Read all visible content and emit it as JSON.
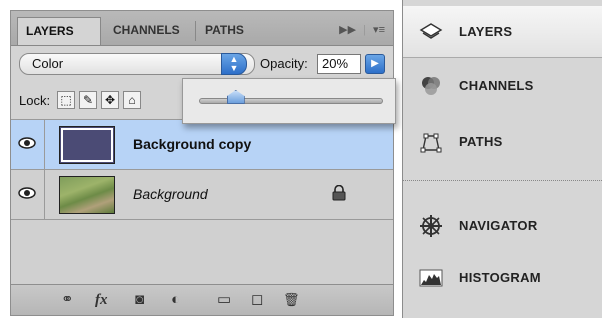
{
  "layers_panel": {
    "tabs": [
      "LAYERS",
      "CHANNELS",
      "PATHS"
    ],
    "tabbar_icons": {
      "collapse": "▶▶",
      "menu": "▾≡"
    },
    "blend_mode": "Color",
    "opacity_label": "Opacity:",
    "opacity_value": "20%",
    "opacity_slider_level": 0.2,
    "lock_label": "Lock:",
    "lock_icons": [
      "transparency-lock-icon",
      "brush-lock-icon",
      "move-lock-icon",
      "padlock-icon"
    ],
    "layers": [
      {
        "name": "Background copy",
        "selected": true,
        "visible": true,
        "locked": false
      },
      {
        "name": "Background",
        "selected": false,
        "visible": true,
        "locked": true
      }
    ],
    "bottom_icons": [
      "link-icon",
      "fx-icon",
      "mask-icon",
      "adjustment-icon",
      "folder-icon",
      "new-layer-icon",
      "trash-icon"
    ],
    "bottom_glyphs": {
      "link": "⚭",
      "fx": "fx",
      "mask": "◙",
      "adjustment": "◐",
      "folder": "▭",
      "new": "◻",
      "trash": "🗑"
    }
  },
  "dock": {
    "items": [
      {
        "label": "LAYERS",
        "icon": "layers-icon",
        "active": true
      },
      {
        "label": "CHANNELS",
        "icon": "channels-icon",
        "active": false
      },
      {
        "label": "PATHS",
        "icon": "paths-icon",
        "active": false
      },
      {
        "label": "NAVIGATOR",
        "icon": "navigator-icon",
        "active": false
      },
      {
        "label": "HISTOGRAM",
        "icon": "histogram-icon",
        "active": false
      }
    ]
  },
  "colors": {
    "selected_row": "#b7d3f6",
    "accent_blue": "#2d6fc9",
    "layer_fill": "#4b4b75"
  }
}
